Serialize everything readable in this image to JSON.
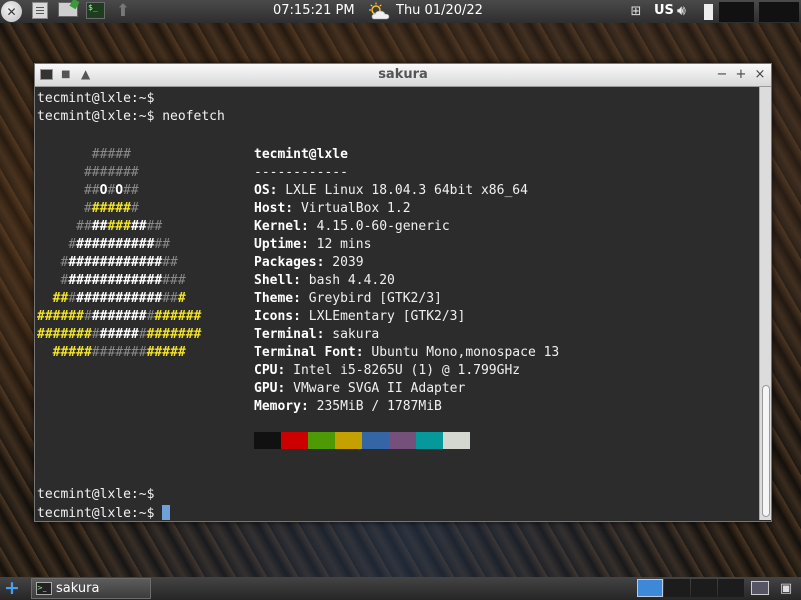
{
  "top_panel": {
    "clock": "07:15:21 PM",
    "date": "Thu 01/20/22",
    "keyboard_layout": "US",
    "icons": [
      "lxle-logo-icon",
      "file-manager-icon",
      "system-monitor-icon",
      "terminal-icon",
      "update-arrow-icon",
      "weather-icon",
      "network-icon",
      "volume-icon",
      "battery-icon"
    ]
  },
  "window": {
    "title": "sakura",
    "controls": {
      "minimize": "−",
      "maximize": "+",
      "close": "×",
      "stick": "■",
      "shade": "▲"
    },
    "terminal": {
      "prompt_lines_top": [
        "tecmint@lxle:~$",
        "tecmint@lxle:~$ neofetch"
      ],
      "info_lines": [
        {
          "key": "tecmint@lxle",
          "sep": "",
          "value": ""
        },
        {
          "key": "",
          "sep": "",
          "value": "------------"
        },
        {
          "key": "OS",
          "sep": ":",
          "value": " LXLE Linux 18.04.3 64bit x86_64"
        },
        {
          "key": "Host",
          "sep": ":",
          "value": " VirtualBox 1.2"
        },
        {
          "key": "Kernel",
          "sep": ":",
          "value": " 4.15.0-60-generic"
        },
        {
          "key": "Uptime",
          "sep": ":",
          "value": " 12 mins"
        },
        {
          "key": "Packages",
          "sep": ":",
          "value": " 2039"
        },
        {
          "key": "Shell",
          "sep": ":",
          "value": " bash 4.4.20"
        },
        {
          "key": "Theme",
          "sep": ":",
          "value": " Greybird [GTK2/3]"
        },
        {
          "key": "Icons",
          "sep": ":",
          "value": " LXLEmentary [GTK2/3]"
        },
        {
          "key": "Terminal",
          "sep": ":",
          "value": " sakura"
        },
        {
          "key": "Terminal Font",
          "sep": ":",
          "value": " Ubuntu Mono,monospace 13"
        },
        {
          "key": "CPU",
          "sep": ":",
          "value": " Intel i5-8265U (1) @ 1.799GHz"
        },
        {
          "key": "GPU",
          "sep": ":",
          "value": " VMware SVGA II Adapter"
        },
        {
          "key": "Memory",
          "sep": ":",
          "value": " 235MiB / 1787MiB"
        }
      ],
      "ascii_art": [
        [
          [
            "       ",
            ""
          ],
          [
            "#####",
            "g"
          ]
        ],
        [
          [
            "      ",
            ""
          ],
          [
            "#######",
            "g"
          ]
        ],
        [
          [
            "      ",
            ""
          ],
          [
            "##",
            "g"
          ],
          [
            "O",
            "w"
          ],
          [
            "#",
            "g"
          ],
          [
            "O",
            "w"
          ],
          [
            "##",
            "g"
          ]
        ],
        [
          [
            "      ",
            ""
          ],
          [
            "#",
            "g"
          ],
          [
            "#####",
            "y"
          ],
          [
            "#",
            "g"
          ]
        ],
        [
          [
            "     ",
            ""
          ],
          [
            "##",
            "g"
          ],
          [
            "##",
            "w"
          ],
          [
            "###",
            "y"
          ],
          [
            "##",
            "w"
          ],
          [
            "##",
            "g"
          ]
        ],
        [
          [
            "    ",
            ""
          ],
          [
            "#",
            "g"
          ],
          [
            "##########",
            "w"
          ],
          [
            "##",
            "g"
          ]
        ],
        [
          [
            "   ",
            ""
          ],
          [
            "#",
            "g"
          ],
          [
            "############",
            "w"
          ],
          [
            "##",
            "g"
          ]
        ],
        [
          [
            "   ",
            ""
          ],
          [
            "#",
            "g"
          ],
          [
            "############",
            "w"
          ],
          [
            "###",
            "g"
          ]
        ],
        [
          [
            "  ",
            ""
          ],
          [
            "##",
            "y"
          ],
          [
            "#",
            "g"
          ],
          [
            "###########",
            "w"
          ],
          [
            "##",
            "g"
          ],
          [
            "#",
            "y"
          ]
        ],
        [
          [
            "######",
            "y"
          ],
          [
            "#",
            "g"
          ],
          [
            "#######",
            "w"
          ],
          [
            "#",
            "g"
          ],
          [
            "######",
            "y"
          ]
        ],
        [
          [
            "#######",
            "y"
          ],
          [
            "#",
            "g"
          ],
          [
            "#####",
            "w"
          ],
          [
            "#",
            "g"
          ],
          [
            "#######",
            "y"
          ]
        ],
        [
          [
            "  ",
            ""
          ],
          [
            "#####",
            "y"
          ],
          [
            "#######",
            "g"
          ],
          [
            "#####",
            "y"
          ]
        ]
      ],
      "color_swatches": [
        "#111111",
        "#cc0000",
        "#4e9a06",
        "#c4a000",
        "#3465a4",
        "#75507b",
        "#06989a",
        "#d3d7cf"
      ],
      "prompt_lines_bottom": [
        "tecmint@lxle:~$",
        "tecmint@lxle:~$ "
      ]
    }
  },
  "bottom_panel": {
    "menu_icon": "+",
    "task_label": "sakura",
    "workspaces": 4
  }
}
